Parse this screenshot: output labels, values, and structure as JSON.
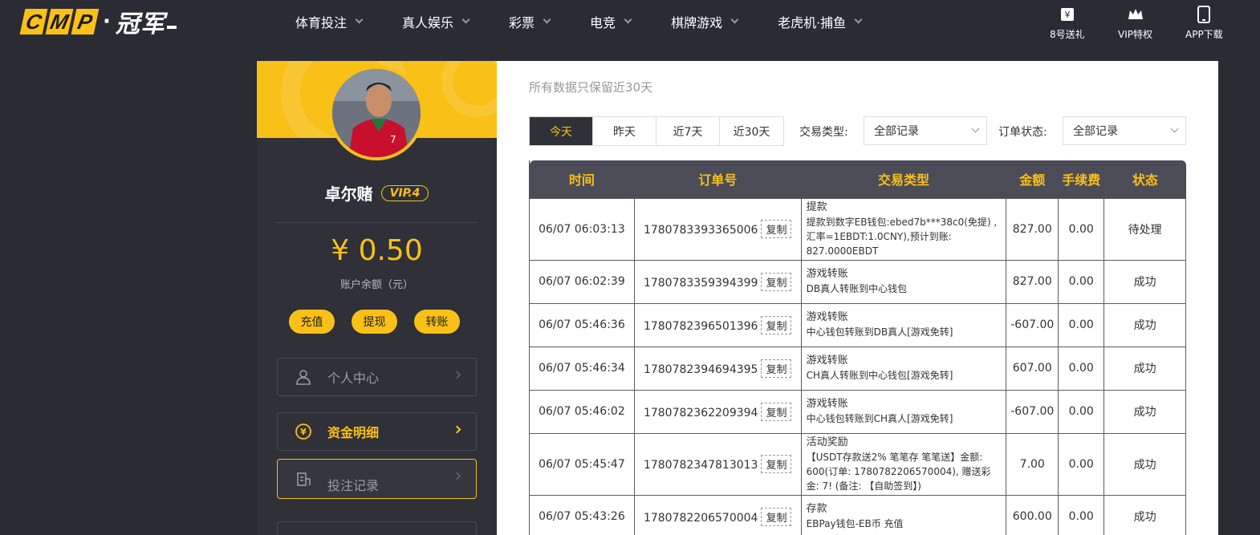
{
  "logo": {
    "letters": [
      "C",
      "M",
      "P"
    ],
    "dot": "·",
    "cn": "冠军"
  },
  "nav": [
    {
      "label": "体育投注"
    },
    {
      "label": "真人娱乐"
    },
    {
      "label": "彩票"
    },
    {
      "label": "电竞"
    },
    {
      "label": "棋牌游戏"
    },
    {
      "label": "老虎机·捕鱼"
    }
  ],
  "quick": [
    {
      "label": "8号送礼",
      "icon": "gift-icon"
    },
    {
      "label": "VIP特权",
      "icon": "crown-icon"
    },
    {
      "label": "APP下载",
      "icon": "phone-icon"
    }
  ],
  "sidebar": {
    "username": "卓尔赌",
    "vip": "VIP.4",
    "balance": "¥ 0.50",
    "balance_label": "账户余额（元）",
    "actions": [
      "充值",
      "提现",
      "转账"
    ],
    "menu": [
      {
        "label": "个人中心",
        "icon": "user-icon"
      },
      {
        "label": "资金明细",
        "icon": "yen-coin-icon",
        "active": true
      },
      {
        "label": "投注记录",
        "icon": "receipt-icon"
      }
    ]
  },
  "main": {
    "subtitle": "所有数据只保留近30天",
    "tabs": [
      {
        "label": "今天",
        "active": true
      },
      {
        "label": "昨天"
      },
      {
        "label": "近7天"
      },
      {
        "label": "近30天"
      }
    ],
    "filter_type_label": "交易类型:",
    "filter_type_value": "全部记录",
    "filter_status_label": "订单状态:",
    "filter_status_value": "全部记录",
    "columns": [
      "时间",
      "订单号",
      "交易类型",
      "金额",
      "手续费",
      "状态"
    ],
    "copy_label": "复制",
    "rows": [
      {
        "time": "06/07 06:03:13",
        "order": "1780783393365006",
        "type": "提款",
        "detail": "提款到数字EB钱包:ebed7b***38c0(免提) ,汇率=1EBDT:1.0CNY),预计到账: 827.0000EBDT",
        "amount": "827.00",
        "fee": "0.00",
        "status": "待处理"
      },
      {
        "time": "06/07 06:02:39",
        "order": "1780783359394399",
        "type": "游戏转账",
        "detail": "DB真人转账到中心钱包",
        "amount": "827.00",
        "fee": "0.00",
        "status": "成功"
      },
      {
        "time": "06/07 05:46:36",
        "order": "1780782396501396",
        "type": "游戏转账",
        "detail": "中心钱包转账到DB真人[游戏免转]",
        "amount": "-607.00",
        "fee": "0.00",
        "status": "成功"
      },
      {
        "time": "06/07 05:46:34",
        "order": "1780782394694395",
        "type": "游戏转账",
        "detail": "CH真人转账到中心钱包[游戏免转]",
        "amount": "607.00",
        "fee": "0.00",
        "status": "成功"
      },
      {
        "time": "06/07 05:46:02",
        "order": "1780782362209394",
        "type": "游戏转账",
        "detail": "中心钱包转账到CH真人[游戏免转]",
        "amount": "-607.00",
        "fee": "0.00",
        "status": "成功"
      },
      {
        "time": "06/07 05:45:47",
        "order": "1780782347813013",
        "type": "活动奖励",
        "detail": "【USDT存款送2% 笔笔存 笔笔送】金额: 600(订单: 1780782206570004), 赠送彩金: 7! (备注: 【自助签到】)",
        "amount": "7.00",
        "fee": "0.00",
        "status": "成功"
      },
      {
        "time": "06/07 05:43:26",
        "order": "1780782206570004",
        "type": "存款",
        "detail": "EBPay钱包-EB币 充值",
        "amount": "600.00",
        "fee": "0.00",
        "status": "成功"
      }
    ]
  },
  "colors": {
    "accent": "#f9c017",
    "dark": "#2a2b33",
    "success": "#2a9d3a"
  }
}
